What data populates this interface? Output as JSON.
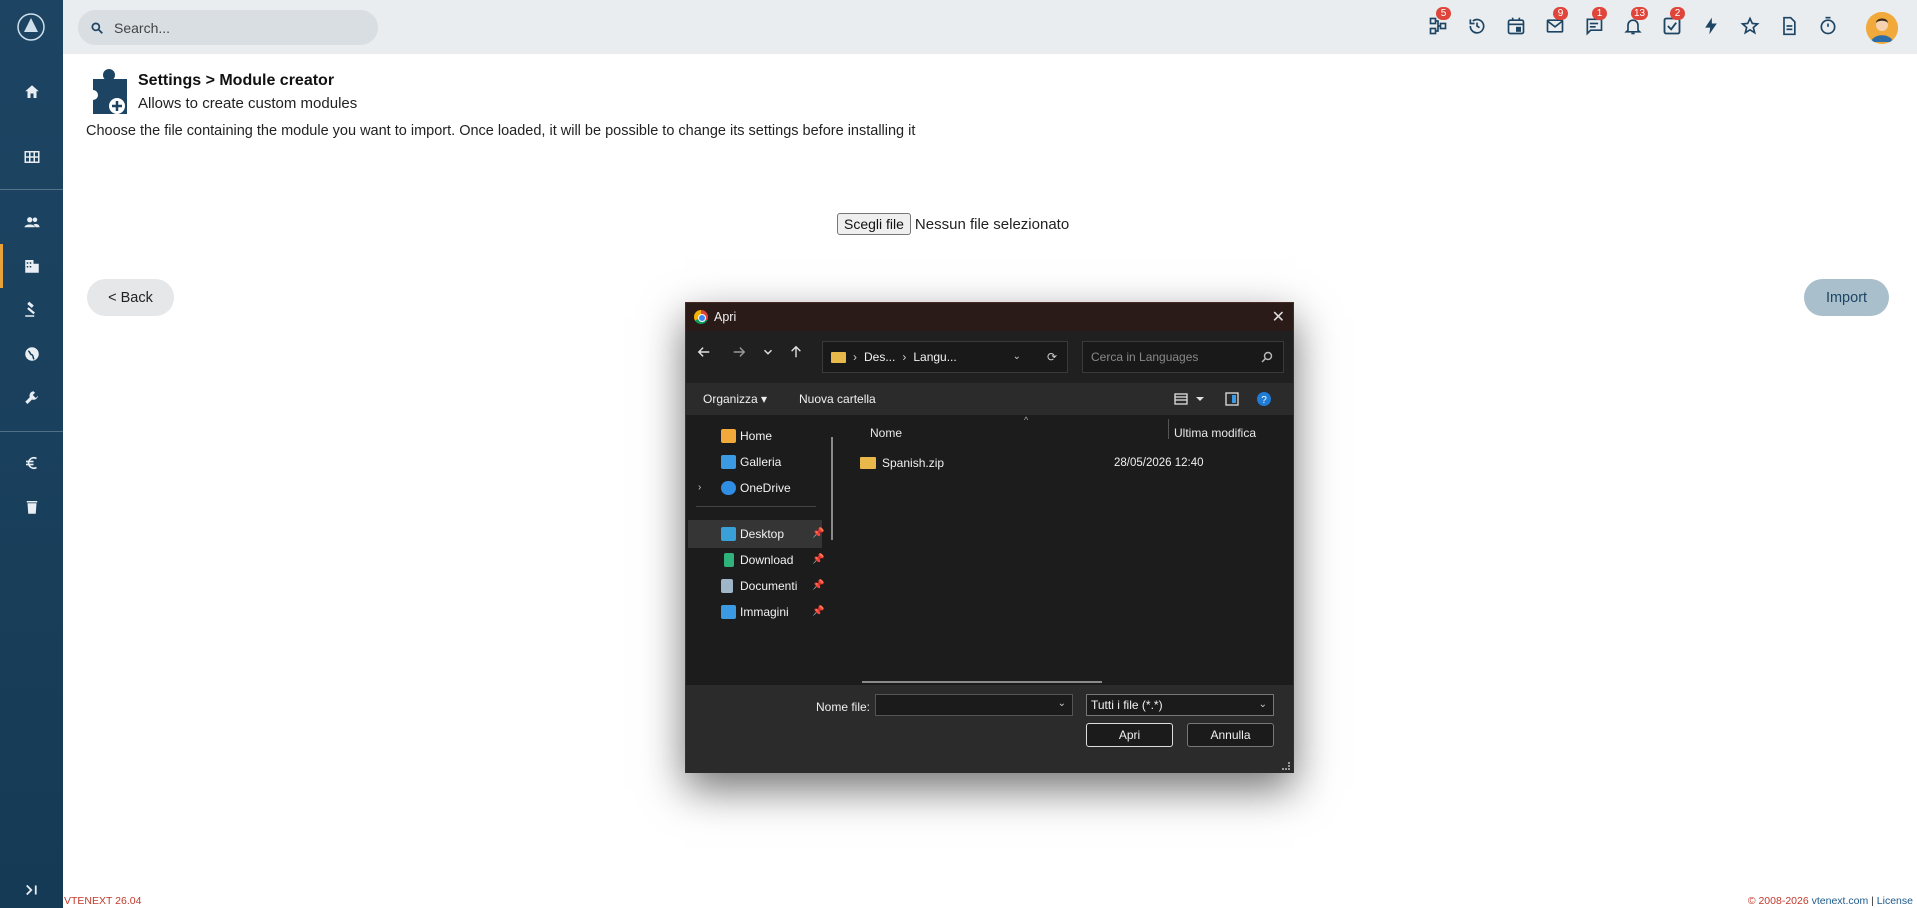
{
  "topbar": {
    "search_placeholder": "Search...",
    "badges": {
      "processes": "5",
      "mail": "9",
      "messages": "1",
      "notifications": "13",
      "tasks": "2"
    }
  },
  "header": {
    "title": "Settings > Module creator",
    "subtitle": "Allows to create custom modules",
    "description": "Choose the file containing the module you want to import. Once loaded, it will be possible to change its settings before installing it"
  },
  "file_input": {
    "button_label": "Scegli file",
    "status": "Nessun file selezionato"
  },
  "actions": {
    "back_label": "< Back",
    "import_label": "Import"
  },
  "footer": {
    "version": "VTENEXT 26.04",
    "copyright": "© 2008-2026",
    "site": "vtenext.com",
    "separator": "|",
    "license": "License"
  },
  "dialog": {
    "title": "Apri",
    "close_glyph": "✕",
    "path": [
      "Des...",
      "Langu..."
    ],
    "search_placeholder": "Cerca in Languages",
    "toolbar": {
      "organize": "Organizza ▾",
      "new_folder": "Nuova cartella"
    },
    "nav": {
      "home": "Home",
      "gallery": "Galleria",
      "onedrive": "OneDrive",
      "desktop": "Desktop",
      "downloads": "Download",
      "documents": "Documenti",
      "pictures": "Immagini"
    },
    "columns": {
      "name": "Nome",
      "modified": "Ultima modifica"
    },
    "files": [
      {
        "name": "Spanish.zip",
        "modified": "28/05/2026 12:40"
      }
    ],
    "filename_label": "Nome file:",
    "filetype": "Tutti i file (*.*)",
    "open_label": "Apri",
    "cancel_label": "Annulla"
  },
  "colors": {
    "sidebar": "#1d4563",
    "accent": "#e8a23a",
    "badge": "#e0453b",
    "import_button": "#a9bfcb"
  }
}
